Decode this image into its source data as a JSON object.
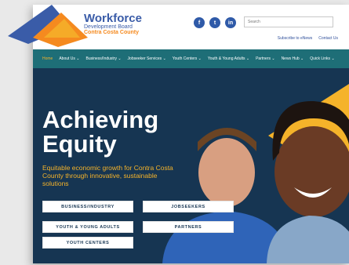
{
  "brand": {
    "name": "Workforce",
    "line1": "Development Board",
    "line2": "Contra Costa County"
  },
  "social": {
    "facebook": "f",
    "twitter": "t",
    "linkedin": "in"
  },
  "search": {
    "placeholder": "Search"
  },
  "toplinks": [
    "Subscribe to eNews",
    "Contact Us"
  ],
  "nav": [
    "Home",
    "About Us ⌄",
    "Business/Industry ⌄",
    "Jobseeker Services ⌄",
    "Youth Centers ⌄",
    "Youth & Young Adults ⌄",
    "Partners ⌄",
    "News Hub ⌄",
    "Quick Links ⌄"
  ],
  "hero": {
    "title_line1": "Achieving",
    "title_line2": "Equity",
    "subtitle": "Equitable economic growth for Contra Costa County through innovative, sustainable solutions",
    "buttons": [
      "BUSINESS/INDUSTRY",
      "JOBSEEKERS",
      "YOUTH & YOUNG ADULTS",
      "PARTNERS",
      "YOUTH CENTERS"
    ]
  },
  "colors": {
    "brand_blue": "#3a5ca8",
    "brand_orange": "#f58a1f",
    "nav_teal": "#1e6e77",
    "hero_navy": "#163552",
    "accent_yellow": "#f5b32a"
  }
}
